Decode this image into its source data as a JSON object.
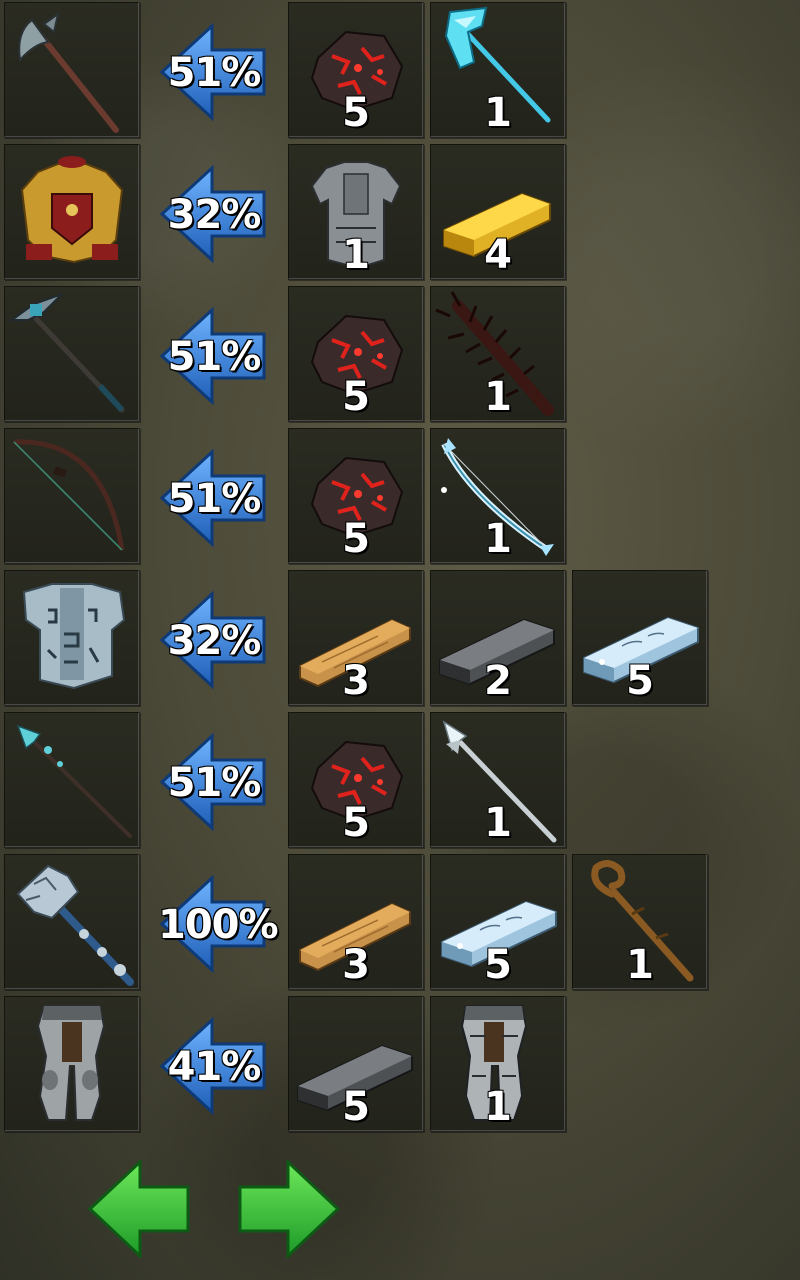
{
  "recipes": [
    {
      "percent": "51%",
      "result_icon": "axe-icon",
      "ingredients": [
        {
          "icon": "ore-icon",
          "count": "5"
        },
        {
          "icon": "ice-axe-icon",
          "count": "1"
        }
      ]
    },
    {
      "percent": "32%",
      "result_icon": "gold-armor-icon",
      "ingredients": [
        {
          "icon": "steel-armor-icon",
          "count": "1"
        },
        {
          "icon": "gold-bar-icon",
          "count": "4"
        }
      ]
    },
    {
      "percent": "51%",
      "result_icon": "pickaxe-icon",
      "ingredients": [
        {
          "icon": "ore-icon",
          "count": "5"
        },
        {
          "icon": "spiked-club-icon",
          "count": "1"
        }
      ]
    },
    {
      "percent": "51%",
      "result_icon": "bow-icon",
      "ingredients": [
        {
          "icon": "ore-icon",
          "count": "5"
        },
        {
          "icon": "ice-bow-icon",
          "count": "1"
        }
      ]
    },
    {
      "percent": "32%",
      "result_icon": "rune-armor-icon",
      "ingredients": [
        {
          "icon": "wood-plank-icon",
          "count": "3"
        },
        {
          "icon": "iron-bar-icon",
          "count": "2"
        },
        {
          "icon": "mithril-bar-icon",
          "count": "5"
        }
      ]
    },
    {
      "percent": "51%",
      "result_icon": "spear-icon",
      "ingredients": [
        {
          "icon": "ore-icon",
          "count": "5"
        },
        {
          "icon": "silver-spear-icon",
          "count": "1"
        }
      ]
    },
    {
      "percent": "100%",
      "result_icon": "warhammer-icon",
      "ingredients": [
        {
          "icon": "wood-plank-icon",
          "count": "3"
        },
        {
          "icon": "mithril-bar-icon",
          "count": "5"
        },
        {
          "icon": "wooden-staff-icon",
          "count": "1"
        }
      ]
    },
    {
      "percent": "41%",
      "result_icon": "plate-leggings-icon",
      "ingredients": [
        {
          "icon": "iron-bar-icon",
          "count": "5"
        },
        {
          "icon": "steel-leggings-icon",
          "count": "1"
        }
      ]
    }
  ],
  "navigation": {
    "previous_icon": "arrow-left-icon",
    "next_icon": "arrow-right-icon"
  },
  "colors": {
    "conversion_arrow": "#2f7fd6",
    "nav_arrow": "#3cc43c",
    "slot_background": "#26271e"
  }
}
